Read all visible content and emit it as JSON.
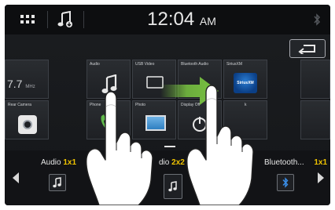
{
  "status_bar": {
    "menu_icon": "grid-icon",
    "source_icon": "music-note-icon",
    "clock_time": "12:04",
    "clock_ampm": "AM",
    "bluetooth_icon": "bluetooth-icon"
  },
  "back_button": {
    "icon": "return-arrow-icon"
  },
  "tiles": [
    {
      "label": "",
      "value": "7.7",
      "unit": "MHz",
      "icon": ""
    },
    {
      "label": "Audio",
      "icon": "music-note-icon"
    },
    {
      "label": "USB Video",
      "icon": "usb-video-icon"
    },
    {
      "label": "Bluetooth Audio",
      "icon": "bluetooth-icon"
    },
    {
      "label": "SiriusXM",
      "icon": "siriusxm-logo-icon"
    },
    {
      "label": "Rear Camera",
      "icon": "camera-icon"
    },
    {
      "label": "Phone",
      "icon": "phone-icon"
    },
    {
      "label": "Photo",
      "icon": "photo-icon"
    },
    {
      "label": "Display Off",
      "icon": "power-icon"
    },
    {
      "label": "k",
      "icon": ""
    }
  ],
  "siriusxm_logo_text": "SiriusXM",
  "dock": [
    {
      "name": "Audio",
      "dim": "1x1",
      "icon_label": "Audio"
    },
    {
      "name": "dio",
      "dim": "2x2",
      "icon_label": ""
    },
    {
      "name": "Bluetooth...",
      "dim": "1x1",
      "icon_label": "Bluetooth Settings"
    }
  ],
  "colors": {
    "accent_yellow": "#f0c400",
    "arrow_green": "#79c441"
  }
}
